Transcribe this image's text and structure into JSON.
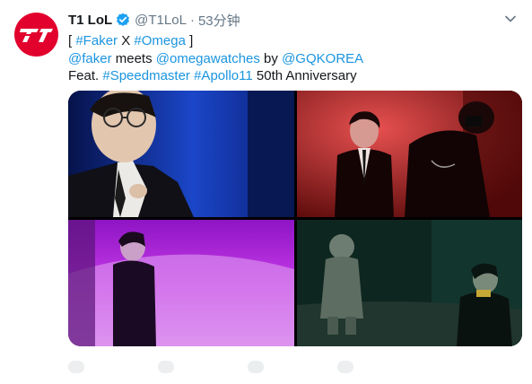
{
  "tweet": {
    "display_name": "T1 LoL",
    "handle": "@T1LoL",
    "separator": "·",
    "time": "53分钟",
    "line1": {
      "open_bracket": "[ ",
      "tag1": "#Faker",
      "x": " X ",
      "tag2": "#Omega",
      "close_bracket": " ]"
    },
    "line2": {
      "mention1": "@faker",
      "meets": " meets ",
      "mention2": "@omegawatches",
      "by": " by ",
      "mention3": "@GQKOREA"
    },
    "line3": {
      "feat": "Feat. ",
      "tag1": "#Speedmaster",
      "space": " ",
      "tag2": "#Apollo11",
      "suffix": " 50th Anniversary"
    }
  },
  "icons": {
    "avatar": "t1-logo",
    "verified": "verified-badge-icon",
    "caret": "chevron-down-icon"
  },
  "colors": {
    "link": "#1b95e0",
    "verified": "#1da1f2",
    "avatar_bg": "#e2012d",
    "secondary_text": "#657786"
  }
}
